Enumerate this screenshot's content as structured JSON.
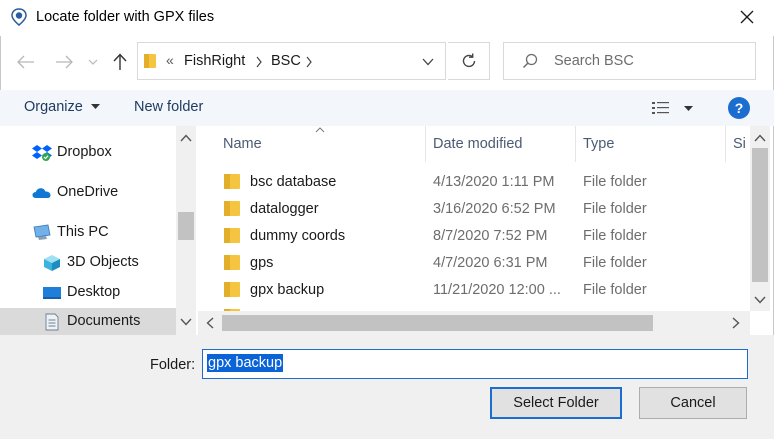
{
  "window": {
    "title": "Locate folder with GPX files"
  },
  "address": {
    "overflow": "«",
    "path": [
      "FishRight",
      "BSC"
    ]
  },
  "search": {
    "placeholder": "Search BSC"
  },
  "toolbar": {
    "organize": "Organize",
    "new_folder": "New folder",
    "help": "?"
  },
  "navpane": {
    "items": [
      {
        "label": "Dropbox",
        "icon": "dropbox-icon"
      },
      {
        "label": "OneDrive",
        "icon": "onedrive-icon"
      },
      {
        "label": "This PC",
        "icon": "pc-icon"
      },
      {
        "label": "3D Objects",
        "icon": "3d-objects-icon"
      },
      {
        "label": "Desktop",
        "icon": "desktop-icon"
      },
      {
        "label": "Documents",
        "icon": "documents-icon",
        "selected": true
      }
    ]
  },
  "filelist": {
    "columns": [
      "Name",
      "Date modified",
      "Type",
      "Si"
    ],
    "rows": [
      {
        "name": "bsc database",
        "date": "4/13/2020 1:11 PM",
        "type": "File folder"
      },
      {
        "name": "datalogger",
        "date": "3/16/2020 6:52 PM",
        "type": "File folder"
      },
      {
        "name": "dummy coords",
        "date": "8/7/2020 7:52 PM",
        "type": "File folder"
      },
      {
        "name": "gps",
        "date": "4/7/2020 6:31 PM",
        "type": "File folder"
      },
      {
        "name": "gpx backup",
        "date": "11/21/2020 12:00 ...",
        "type": "File folder"
      }
    ]
  },
  "footer": {
    "folder_label": "Folder:",
    "folder_value": "gpx backup",
    "select_label": "Select Folder",
    "cancel_label": "Cancel"
  },
  "colors": {
    "accent": "#1c6dd0",
    "folder": "#f5c542",
    "selection": "#0a64d8"
  }
}
